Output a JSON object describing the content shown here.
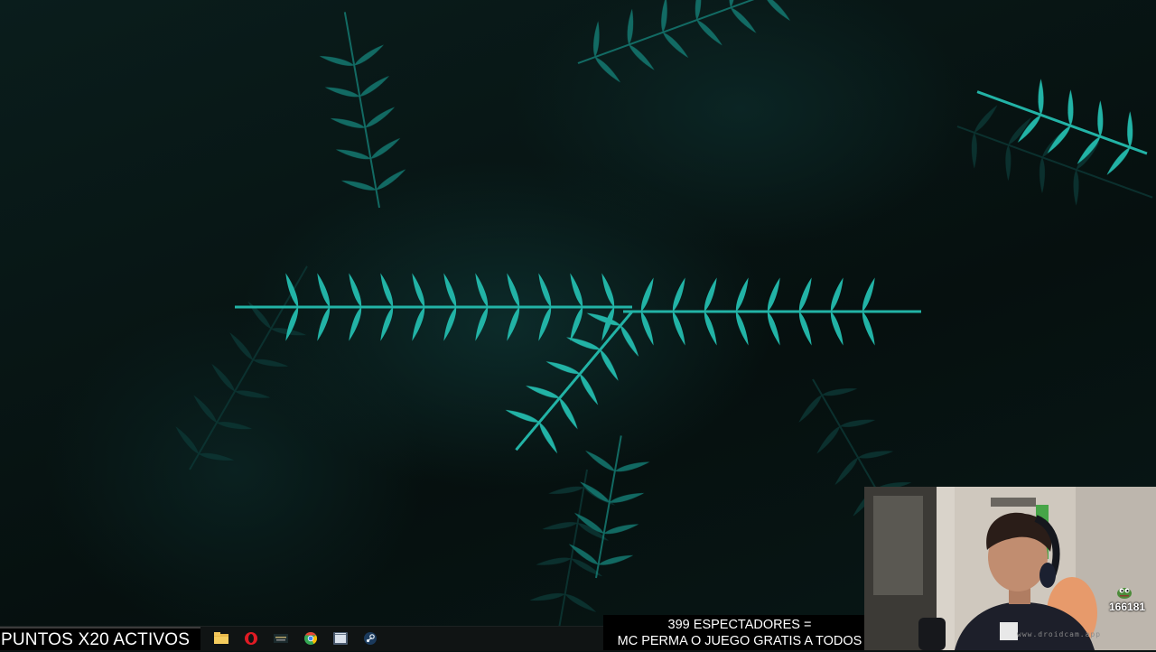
{
  "banners": {
    "points": "PUNTOS X20 ACTIVOS",
    "viewers_line1": "399 ESPECTADORES =",
    "viewers_line2": "MC PERMA O JUEGO GRATIS A TODOS"
  },
  "webcam": {
    "watermark": "www.droidcam.app",
    "emote_count": "166181"
  },
  "taskbar": {
    "icons": [
      "folder-icon",
      "opera-icon",
      "league-client-icon",
      "chrome-icon",
      "window-app-icon",
      "steam-icon"
    ]
  },
  "colors": {
    "fern": "#1fa89d",
    "background": "#071312",
    "banner_bg": "#000000",
    "banner_text": "#ffffff"
  }
}
